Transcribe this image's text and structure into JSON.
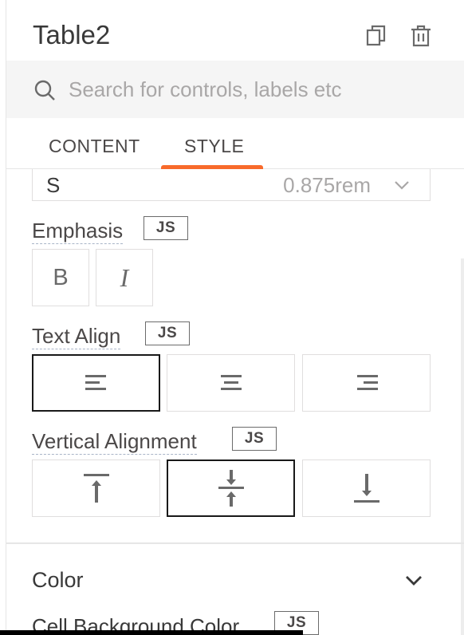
{
  "header": {
    "title": "Table2",
    "icons": [
      "copy-icon",
      "delete-icon"
    ]
  },
  "search": {
    "placeholder": "Search for controls, labels etc",
    "icon": "search-icon"
  },
  "tabs": [
    {
      "label": "CONTENT",
      "active": false
    },
    {
      "label": "STYLE",
      "active": true
    }
  ],
  "font_size": {
    "selected_label": "S",
    "selected_value": "0.875rem"
  },
  "emphasis": {
    "label": "Emphasis",
    "js_label": "JS",
    "options": [
      "B",
      "I"
    ]
  },
  "text_align": {
    "label": "Text Align",
    "js_label": "JS",
    "options": [
      "left",
      "center",
      "right"
    ],
    "selected": "left"
  },
  "vertical_alignment": {
    "label": "Vertical Alignment",
    "js_label": "JS",
    "options": [
      "top",
      "center",
      "bottom"
    ],
    "selected": "center"
  },
  "color_section": {
    "title": "Color",
    "first_property_label": "Cell Background Color",
    "js_label": "JS"
  },
  "colors": {
    "accent": "#f86a2b",
    "text": "#4b4848",
    "border": "#e0dede",
    "active_border": "#191919"
  }
}
